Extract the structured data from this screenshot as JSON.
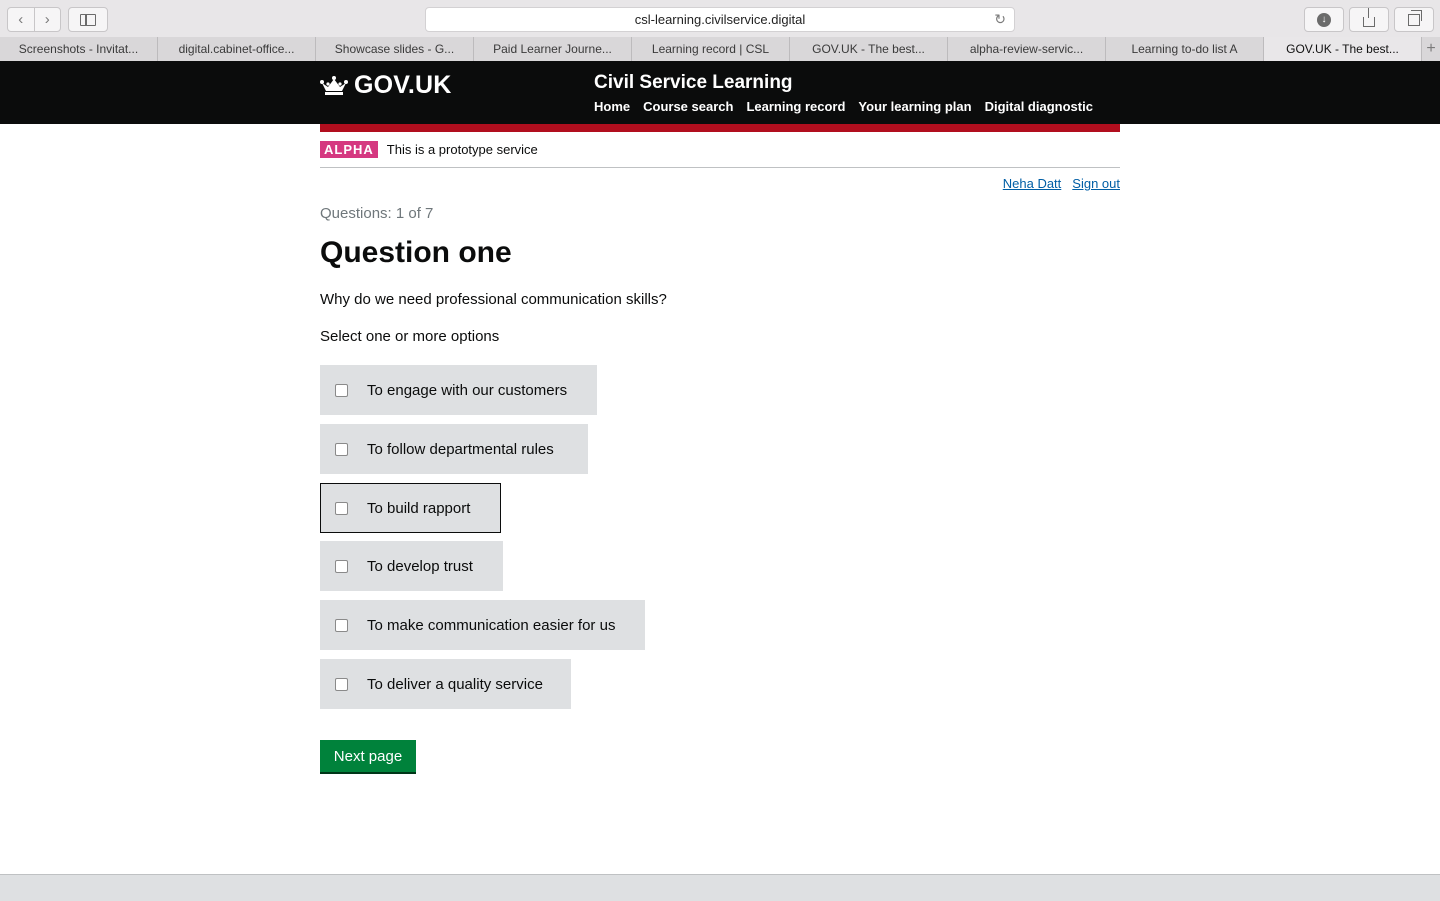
{
  "browser": {
    "url": "csl-learning.civilservice.digital",
    "tabs": [
      {
        "label": "Screenshots - Invitat..."
      },
      {
        "label": "digital.cabinet-office..."
      },
      {
        "label": "Showcase slides - G..."
      },
      {
        "label": "Paid Learner Journe..."
      },
      {
        "label": "Learning record | CSL"
      },
      {
        "label": "GOV.UK - The best..."
      },
      {
        "label": "alpha-review-servic..."
      },
      {
        "label": "Learning to-do list A"
      },
      {
        "label": "GOV.UK - The best..."
      }
    ],
    "active_tab_index": 8,
    "icons": {
      "back": "back-arrow-icon",
      "forward": "forward-arrow-icon",
      "sidebar": "sidebar-icon",
      "reload": "reload-icon",
      "download": "download-icon",
      "share": "share-icon",
      "tabs": "tab-overview-icon",
      "new_tab": "plus-icon"
    }
  },
  "header": {
    "logo": "GOV.UK",
    "service_name": "Civil Service Learning",
    "nav": [
      "Home",
      "Course search",
      "Learning record",
      "Your learning plan",
      "Digital diagnostic"
    ]
  },
  "phase_banner": {
    "tag": "ALPHA",
    "text": "This is a prototype service"
  },
  "user": {
    "name": "Neha Datt",
    "sign_out": "Sign out"
  },
  "question": {
    "progress": "Questions: 1 of 7",
    "heading": "Question one",
    "text": "Why do we need professional communication skills?",
    "hint": "Select one or more options",
    "options": [
      {
        "label": "To engage with our customers",
        "checked": false
      },
      {
        "label": "To follow departmental rules",
        "checked": false
      },
      {
        "label": "To build rapport",
        "checked": false,
        "focused": true
      },
      {
        "label": "To develop trust",
        "checked": false
      },
      {
        "label": "To make communication easier for us",
        "checked": false
      },
      {
        "label": "To deliver a quality service",
        "checked": false
      }
    ],
    "submit": "Next page"
  },
  "colors": {
    "header_bg": "#0b0c0c",
    "red_bar": "#b10e1e",
    "alpha_tag": "#d53880",
    "link": "#005ea5",
    "button": "#00823b",
    "option_bg": "#dee0e2"
  }
}
